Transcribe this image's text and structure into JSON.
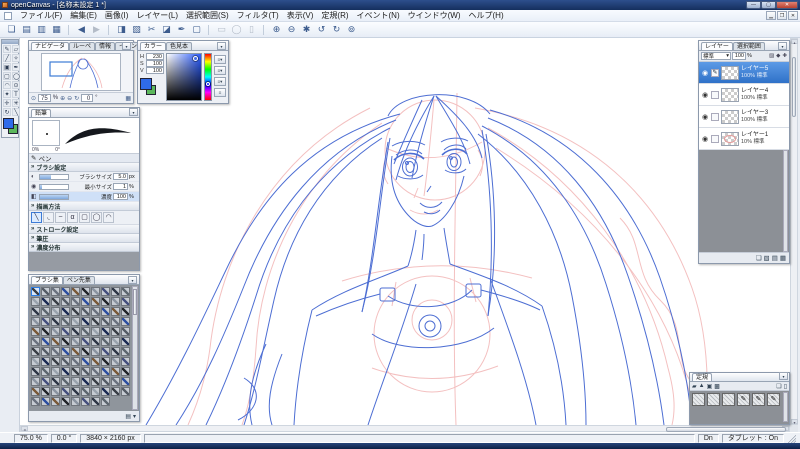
{
  "window": {
    "title": "openCanvas - [名称未設定 1 *]",
    "minimize_glyph": "—",
    "maximize_glyph": "▢",
    "close_glyph": "✕",
    "mdi_minimize_glyph": "▁",
    "mdi_restore_glyph": "❐",
    "mdi_close_glyph": "✕"
  },
  "menu": {
    "items": [
      "ファイル(F)",
      "編集(E)",
      "画像(I)",
      "レイヤー(L)",
      "選択範囲(S)",
      "フィルタ(T)",
      "表示(V)",
      "定規(R)",
      "イベント(N)",
      "ウインドウ(W)",
      "ヘルプ(H)"
    ]
  },
  "toolbar": {
    "buttons": [
      {
        "name": "new-file",
        "glyph": "❏"
      },
      {
        "name": "open-file",
        "glyph": "▤"
      },
      {
        "name": "save-file",
        "glyph": "▥"
      },
      {
        "name": "save-as",
        "glyph": "▦"
      },
      {
        "name": "history-back",
        "glyph": "◀",
        "gap": true
      },
      {
        "name": "history-forward",
        "glyph": "▶",
        "disabled": true
      },
      {
        "name": "copy",
        "glyph": "◨",
        "gap": true
      },
      {
        "name": "paste",
        "glyph": "▧"
      },
      {
        "name": "cut",
        "glyph": "✂"
      },
      {
        "name": "eraser",
        "glyph": "◪"
      },
      {
        "name": "brush",
        "glyph": "✒"
      },
      {
        "name": "select-all",
        "glyph": "▢"
      },
      {
        "name": "select-rect",
        "glyph": "▭",
        "gap": true,
        "disabled": true
      },
      {
        "name": "select-ellipse",
        "glyph": "◯",
        "disabled": true
      },
      {
        "name": "deselect",
        "glyph": "▯",
        "disabled": true
      },
      {
        "name": "zoom-in",
        "glyph": "⊕",
        "gap": true
      },
      {
        "name": "zoom-out",
        "glyph": "⊖"
      },
      {
        "name": "settings",
        "glyph": "✱"
      },
      {
        "name": "undo",
        "glyph": "↺"
      },
      {
        "name": "redo",
        "glyph": "↻"
      },
      {
        "name": "refresh",
        "glyph": "⊚"
      }
    ]
  },
  "toolbox": {
    "tools": [
      {
        "name": "pencil-tool",
        "glyph": "✎"
      },
      {
        "name": "eraser-tool",
        "glyph": "▱"
      },
      {
        "name": "pen-tool",
        "glyph": "╱"
      },
      {
        "name": "airbrush-tool",
        "glyph": "✧"
      },
      {
        "name": "bucket-tool",
        "glyph": "▣"
      },
      {
        "name": "brush-tool",
        "glyph": "✒"
      },
      {
        "name": "rect-select-tool",
        "glyph": "▢"
      },
      {
        "name": "ellipse-select-tool",
        "glyph": "◯"
      },
      {
        "name": "lasso-tool",
        "glyph": "◠"
      },
      {
        "name": "zoom-tool",
        "glyph": "⊙"
      },
      {
        "name": "magic-wand-tool",
        "glyph": "✦"
      },
      {
        "name": "text-tool",
        "glyph": "T"
      },
      {
        "name": "move-tool",
        "glyph": "✛"
      },
      {
        "name": "path-tool",
        "glyph": "✳"
      },
      {
        "name": "rotate-tool",
        "glyph": "↻"
      },
      {
        "name": "eyedropper-tool",
        "glyph": "╲"
      }
    ],
    "foreground_color": "#2f6bea",
    "background_color": "#5cb85c"
  },
  "navigator": {
    "tabs": [
      "ナビゲータ",
      "ルーペ",
      "情報",
      "イベント"
    ],
    "menu_glyph": "▾",
    "zoom_icon": "⊙",
    "zoom_value": "75",
    "zoom_unit": "%",
    "zoom_in_glyph": "⊕",
    "zoom_out_glyph": "⊖",
    "rotate_glyph": "↻",
    "angle_value": "0",
    "angle_unit": "°",
    "grid_glyph": "▦"
  },
  "color_panel": {
    "tabs": [
      "カラー",
      "色見本"
    ],
    "menu_glyph": "▾",
    "fields": [
      {
        "label": "H",
        "value": "230"
      },
      {
        "label": "S",
        "value": "100"
      },
      {
        "label": "V",
        "value": "100"
      }
    ],
    "mode_buttons": [
      {
        "name": "rgb-slider-mode",
        "glyph": "≡▾"
      },
      {
        "name": "hsv-slider-mode",
        "glyph": "≡▾"
      },
      {
        "name": "mix-mode",
        "glyph": "≡▾"
      },
      {
        "name": "options",
        "glyph": "≡"
      }
    ]
  },
  "pen_panel": {
    "tab": "鉛筆",
    "menu_glyph": "▾",
    "tool_icon": "✎",
    "tool_label": "ペン",
    "tip_size_label": "0%",
    "tip_angle_label": "0°",
    "sections": {
      "brush": "ブラシ設定",
      "method": "描画方法",
      "stroke": "ストローク設定",
      "pressure": "筆圧",
      "density": "濃度分布"
    },
    "section_marker": "»",
    "sliders": [
      {
        "label": "ブラシサイズ",
        "value": "5.0",
        "unit": "px",
        "fill": "width:38%",
        "icon": "◐"
      },
      {
        "label": "最小サイズ",
        "value": "1",
        "unit": "%",
        "fill": "width:6%",
        "icon": "◉"
      },
      {
        "label": "濃度",
        "value": "100",
        "unit": "%",
        "fill": "width:100%",
        "icon": "◧",
        "highlight": true
      }
    ],
    "method_icons": [
      {
        "name": "tip-line",
        "glyph": "╲",
        "selected": true
      },
      {
        "name": "tip-curve",
        "glyph": "◟"
      },
      {
        "name": "tip-soft",
        "glyph": "~"
      },
      {
        "name": "tip-alpha",
        "glyph": "α"
      },
      {
        "name": "tip-square",
        "glyph": "▢"
      },
      {
        "name": "tip-circle",
        "glyph": "◯"
      },
      {
        "name": "tip-flat",
        "glyph": "◠"
      }
    ]
  },
  "brush_library": {
    "tabs": [
      "ブラシ集",
      "ペン先集"
    ],
    "menu_glyph": "▾",
    "grid": {
      "count": 118,
      "cols": 10,
      "selected_index": 0,
      "colors": [
        "#3a3f47",
        "#555c66",
        "#6b7280",
        "#2d4fa0",
        "#7a5a3a",
        "#23262b",
        "#8a93a0",
        "#46507e",
        "#303848",
        "#5d666f",
        "#99a2ad",
        "#1d2c55"
      ]
    },
    "foot_icons": [
      {
        "name": "load-set",
        "glyph": "▤"
      },
      {
        "name": "more",
        "glyph": "▾"
      }
    ]
  },
  "layers_panel": {
    "tabs": [
      "レイヤー",
      "選択範囲"
    ],
    "menu_glyph": "▾",
    "blend_mode": "標準",
    "blend_arrow": "▾",
    "opacity_value": "100",
    "opacity_unit": "%",
    "lock_icons": [
      {
        "name": "lock-transparency",
        "glyph": "▨"
      },
      {
        "name": "lock-pixels",
        "glyph": "◆"
      },
      {
        "name": "add-mask",
        "glyph": "✚"
      }
    ],
    "layers": [
      {
        "name": "レイヤー5",
        "detail": "100% 標準",
        "selected": true,
        "editing": true
      },
      {
        "name": "レイヤー4",
        "detail": "100% 標準"
      },
      {
        "name": "レイヤー3",
        "detail": "100% 標準"
      },
      {
        "name": "レイヤー1",
        "detail": "10% 標準",
        "red_thumb": true
      }
    ],
    "eye_glyph": "◉",
    "pencil_glyph": "✎",
    "foot_icons": [
      {
        "name": "new-layer",
        "glyph": "❏"
      },
      {
        "name": "new-layer-set",
        "glyph": "▧"
      },
      {
        "name": "merge-layer",
        "glyph": "▤"
      },
      {
        "name": "delete-layer",
        "glyph": "▦"
      }
    ]
  },
  "ruler_panel": {
    "tab": "定規",
    "menu_glyph": "▾",
    "tool_icons": [
      {
        "name": "ruler-parallel",
        "glyph": "▰"
      },
      {
        "name": "ruler-triangle",
        "glyph": "▲"
      },
      {
        "name": "ruler-grid",
        "glyph": "▣"
      },
      {
        "name": "ruler-perspective",
        "glyph": "▩"
      }
    ],
    "right_icons": [
      {
        "name": "new-ruler",
        "glyph": "❏"
      },
      {
        "name": "delete-ruler",
        "glyph": "▯"
      }
    ],
    "presets": [
      {
        "name": "ruler-preset",
        "glyph": ""
      },
      {
        "name": "ruler-preset",
        "glyph": ""
      },
      {
        "name": "ruler-preset",
        "glyph": ""
      },
      {
        "name": "ruler-preset",
        "glyph": "✎"
      },
      {
        "name": "ruler-preset",
        "glyph": "✎"
      },
      {
        "name": "ruler-preset",
        "glyph": "✎"
      }
    ]
  },
  "statusbar": {
    "zoom": "75.0 %",
    "angle": "0.0 °",
    "canvas_size": "3840 × 2160 px",
    "pen_state": "Dn",
    "tablet": "タブレット : On"
  },
  "scrollbars": {
    "left_glyph": "◂",
    "right_glyph": "▸",
    "up_glyph": "▴",
    "down_glyph": "▾"
  },
  "canvas": {
    "sketch_blue": "#4d6ed3",
    "sketch_red": "#f2b6b6"
  }
}
